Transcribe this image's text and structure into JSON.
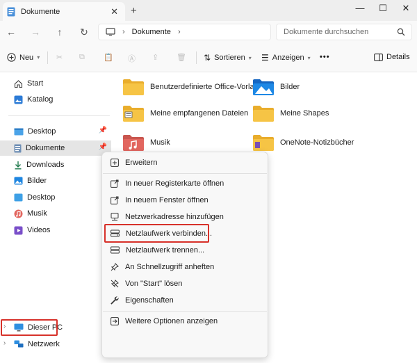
{
  "window": {
    "tab_title": "Dokumente",
    "new_tab_symbol": "+",
    "controls": [
      "minimize-icon",
      "maximize-icon",
      "close-icon"
    ]
  },
  "address": {
    "path": [
      "Dokumente"
    ],
    "search_placeholder": "Dokumente durchsuchen"
  },
  "toolbar": {
    "new_label": "Neu",
    "sort_label": "Sortieren",
    "view_label": "Anzeigen",
    "more_label": "•••",
    "details_label": "Details"
  },
  "sidebar": {
    "items": [
      {
        "label": "Start",
        "icon": "home-icon"
      },
      {
        "label": "Katalog",
        "icon": "gallery-icon"
      },
      {
        "label": "Desktop",
        "icon": "desktop-folder-icon",
        "pinned": true
      },
      {
        "label": "Dokumente",
        "icon": "documents-icon",
        "pinned": true,
        "selected": true
      },
      {
        "label": "Downloads",
        "icon": "download-icon"
      },
      {
        "label": "Bilder",
        "icon": "pictures-icon"
      },
      {
        "label": "Desktop",
        "icon": "desktop-icon"
      },
      {
        "label": "Musik",
        "icon": "music-icon"
      },
      {
        "label": "Videos",
        "icon": "videos-icon"
      },
      {
        "label": "Dieser PC",
        "icon": "this-pc-icon"
      },
      {
        "label": "Netzwerk",
        "icon": "network-icon"
      }
    ]
  },
  "folders": [
    {
      "label": "Benutzerdefinierte Office-Vorlagen",
      "icon": "folder-icon"
    },
    {
      "label": "Bilder",
      "icon": "pictures-folder-icon"
    },
    {
      "label": "Meine empfangenen Dateien",
      "icon": "folder-icon"
    },
    {
      "label": "Meine Shapes",
      "icon": "folder-icon"
    },
    {
      "label": "Musik",
      "icon": "music-folder-icon"
    },
    {
      "label": "OneNote-Notizbücher",
      "icon": "folder-icon"
    }
  ],
  "context_menu": {
    "items": [
      {
        "label": "Erweitern",
        "icon": "expand-icon"
      },
      {
        "label": "In neuer Registerkarte öffnen",
        "icon": "new-tab-icon"
      },
      {
        "label": "In neuem Fenster öffnen",
        "icon": "new-window-icon"
      },
      {
        "label": "Netzwerkadresse hinzufügen",
        "icon": "network-location-icon"
      },
      {
        "label": "Netzlaufwerk verbinden...",
        "icon": "map-drive-icon",
        "highlighted": true
      },
      {
        "label": "Netzlaufwerk trennen...",
        "icon": "disconnect-drive-icon"
      },
      {
        "label": "An Schnellzugriff anheften",
        "icon": "pin-icon"
      },
      {
        "label": "Von \"Start\" lösen",
        "icon": "unpin-icon"
      },
      {
        "label": "Eigenschaften",
        "icon": "properties-icon"
      },
      {
        "label": "Weitere Optionen anzeigen",
        "icon": "more-options-icon"
      }
    ]
  },
  "colors": {
    "highlight_border": "#d7312a",
    "folder_yellow": "#f6c445",
    "accent_blue": "#1a73d9"
  }
}
